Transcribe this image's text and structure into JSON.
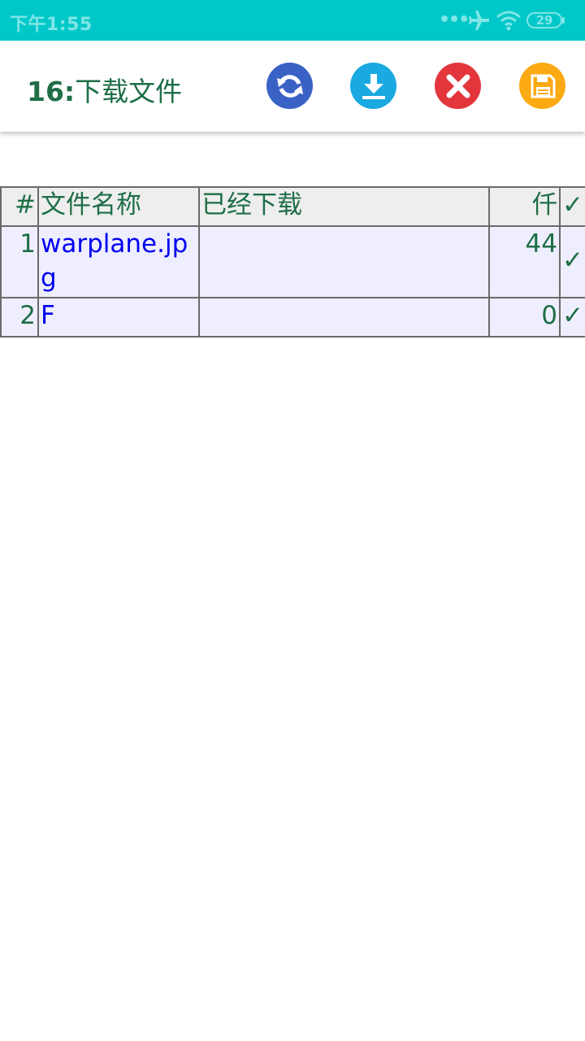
{
  "status_bar": {
    "time": "下午1:55",
    "dots": "•••",
    "battery": "29",
    "colors": {
      "background": "#00c8c8",
      "foreground": "#7fe6e6"
    }
  },
  "toolbar": {
    "title_number": "16:",
    "title_text": "下载文件",
    "buttons": [
      {
        "icon": "refresh-icon",
        "color": "#3a62c6"
      },
      {
        "icon": "download-icon",
        "color": "#1aa9e0"
      },
      {
        "icon": "close-icon",
        "color": "#e2363c"
      },
      {
        "icon": "save-icon",
        "color": "#fbaa13"
      }
    ]
  },
  "table": {
    "headers": {
      "num": "#",
      "name": "文件名称",
      "downloaded": "已经下载",
      "size": "仟",
      "check": "✓"
    },
    "rows": [
      {
        "num": "1",
        "name": "warplane.jpg",
        "downloaded": "",
        "size": "44",
        "check": "✓"
      },
      {
        "num": "2",
        "name": "F",
        "downloaded": "",
        "size": "0",
        "check": "✓"
      }
    ],
    "colors": {
      "header_bg": "#eeeeee",
      "row_bg": "#eeeeff",
      "text": "#1e6e46",
      "link": "#0000ee"
    }
  }
}
